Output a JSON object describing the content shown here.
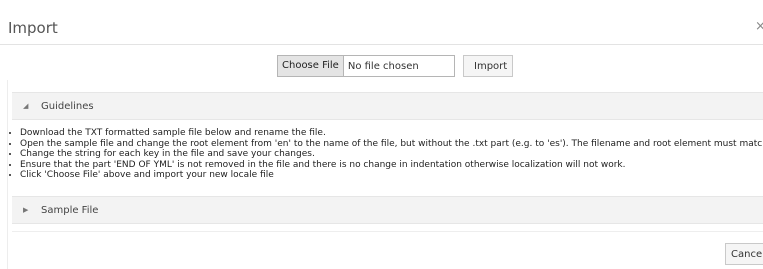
{
  "dialog": {
    "title": "Import",
    "close_glyph": "×"
  },
  "file_picker": {
    "choose_label": "Choose File",
    "status": "No file chosen",
    "import_label": "Import"
  },
  "guidelines": {
    "heading": "Guidelines",
    "toggle_icon": "triangle-expanded-icon",
    "items": [
      "Download the TXT formatted sample file below and rename the file.",
      "Open the sample file and change the root element from 'en' to the name of the file, but without the .txt part (e.g. to 'es'). The filename and root element must match.",
      "Change the string for each key in the file and save your changes.",
      "Ensure that the part 'END OF YML' is not removed in the file and there is no change in indentation otherwise localization will not work.",
      "Click 'Choose File' above and import your new locale file"
    ]
  },
  "sample_file": {
    "heading": "Sample File",
    "toggle_icon": "triangle-collapsed-icon"
  },
  "footer": {
    "cancel_label": "Cancel"
  }
}
